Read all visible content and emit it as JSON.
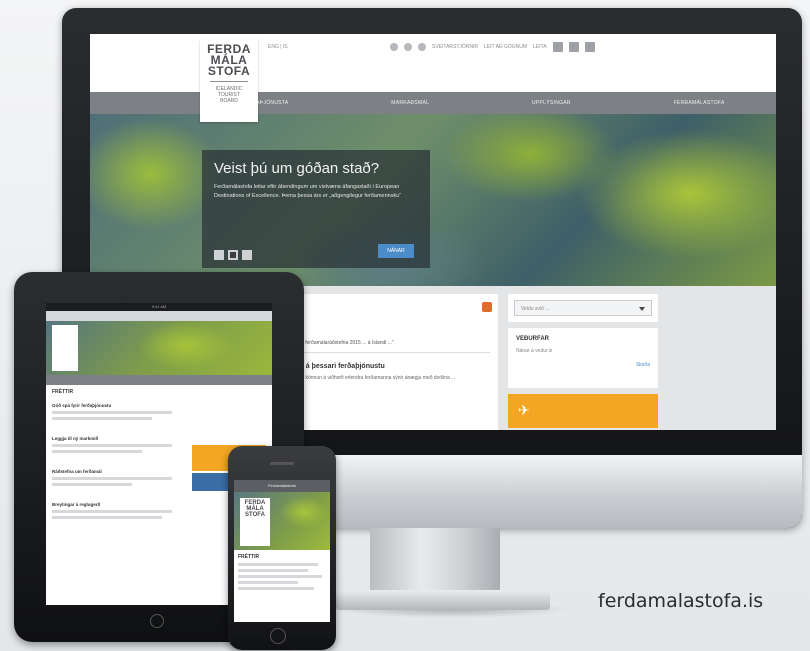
{
  "desktop": {
    "logo": {
      "lines": [
        "FERDA",
        "MÁLA",
        "STOFA"
      ],
      "sub_lines": [
        "ICELANDIC",
        "TOURIST",
        "BOARD"
      ]
    },
    "lang": "ENG | IS",
    "top_links": [
      "SVEITARSTJÓRNIR",
      "LEIT AÐ GÖGNUM",
      "LEITA"
    ],
    "nav": [
      "FERÐAÞJÓNUSTA",
      "MARKAÐSMÁL",
      "UPPLÝSINGAR",
      "FERÐAMÁLASTOFA"
    ],
    "hero": {
      "title": "Veist þú um góðan stað?",
      "text": "Ferðamálastofa leitar eftir ábendingum um vistvæna áfangastaði í European Destinations of Excellence. Þema þessa árs er „aðgengilegur ferðamennsku“",
      "button": "NÁNAR"
    },
    "news": {
      "line": "„... ferðamálaráðstefna 2015 ... á Íslandi ...“",
      "title": "... á þessari ferðaþjónustu",
      "sub": "Ný könnun á viðhorfi erlendra ferðamanna sýnir ánægju með dvölina ..."
    },
    "sidebar": {
      "select": "Veldu svið ...",
      "box_title": "VEÐURFAR",
      "box_sub": "Nánar á vedur.is",
      "box_link": "Skoða"
    }
  },
  "tablet": {
    "status": "9:41 AM",
    "heading": "FRÉTTIR",
    "items": [
      "Góð spá fyrir ferðaþjónustu",
      "Leggja til ný markmið",
      "Ráðstefna um ferðamál",
      "Breytingar á reglugerð"
    ]
  },
  "phone": {
    "title": "Ferðamálastofa",
    "logo": [
      "FERDA",
      "MÁLA",
      "STOFA"
    ],
    "heading": "FRÉTTIR"
  },
  "website_url": "ferdamalastofa.is"
}
